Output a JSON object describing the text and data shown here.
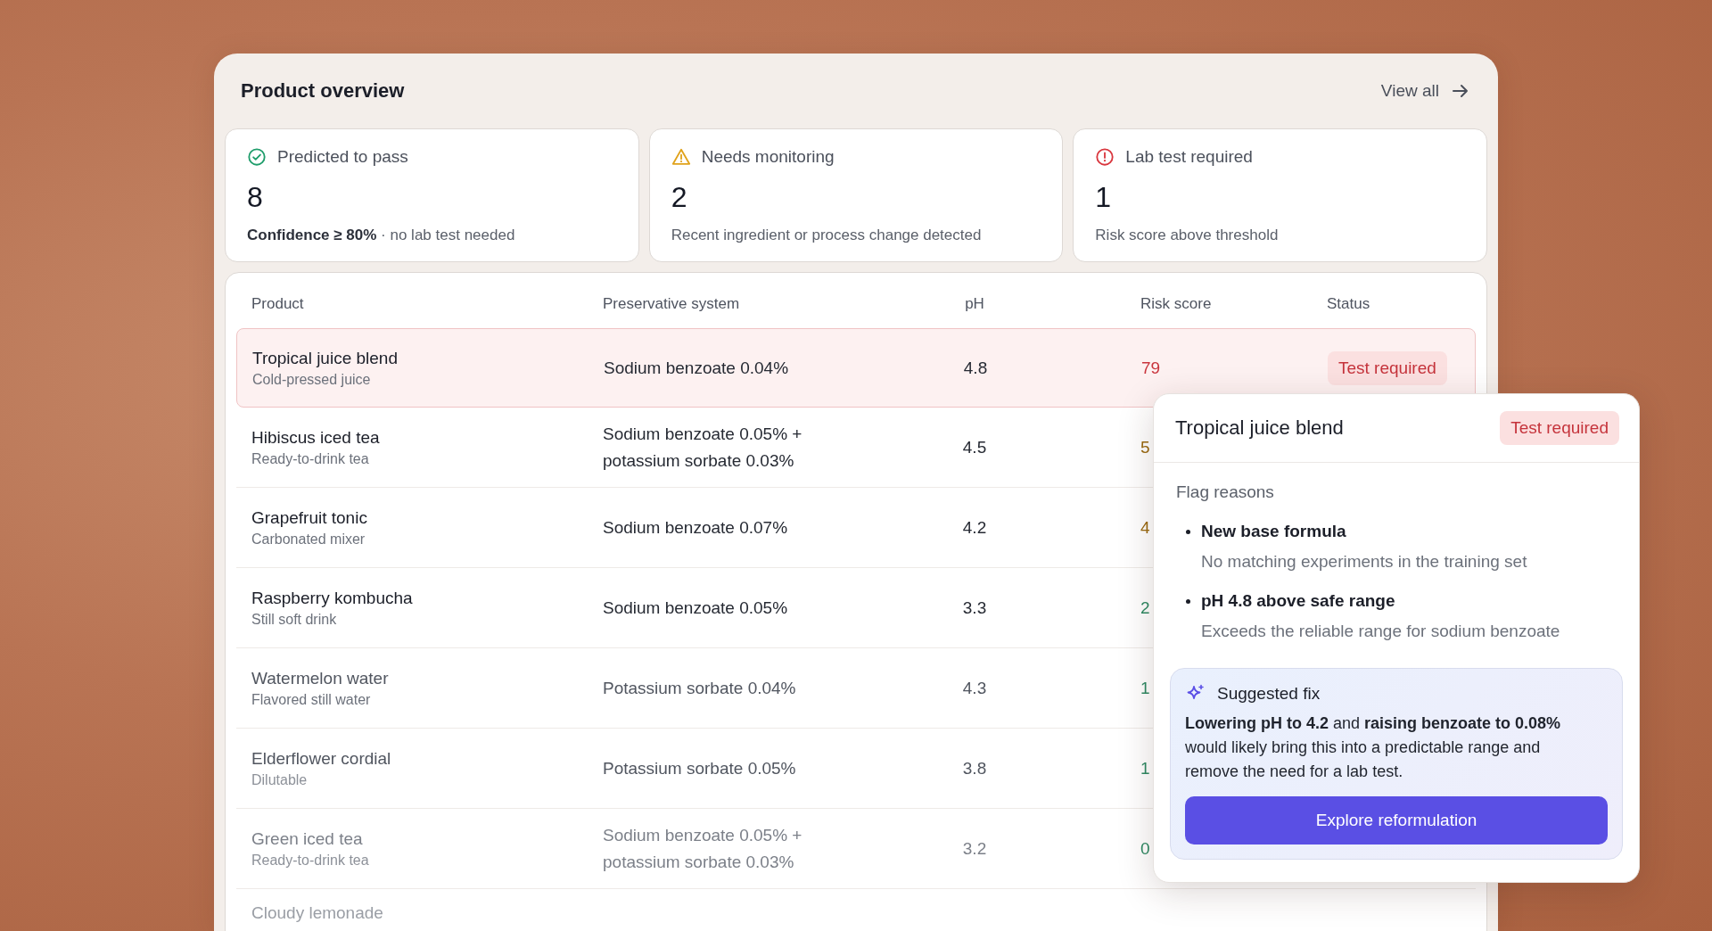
{
  "panel": {
    "title": "Product overview",
    "link": "View all"
  },
  "summary_cards": [
    {
      "kind": "pass",
      "label": "Predicted to pass",
      "count": "8",
      "note": "**Confidence ≥ 80%**  ·  no lab test needed"
    },
    {
      "kind": "warning",
      "label": "Needs monitoring",
      "count": "2",
      "note": "Recent ingredient or process change detected"
    },
    {
      "kind": "alert",
      "label": "Lab test required",
      "count": "1",
      "note": "Risk score above threshold"
    }
  ],
  "table": {
    "columns": [
      "Product",
      "Preservative system",
      "pH",
      "Risk score",
      "Status"
    ],
    "rows": [
      {
        "name": "Tropical juice blend",
        "subtitle": "Cold-pressed juice",
        "preservative": "Sodium benzoate 0.04%",
        "ph": "4.8",
        "risk": "79",
        "color": "#c9353d",
        "status": {
          "label": "Test required",
          "kind": "alert"
        },
        "selected": true
      },
      {
        "name": "Hibiscus iced tea",
        "subtitle": "Ready-to-drink tea",
        "preservative": "Sodium benzoate 0.05% + potassium sorbate 0.03%",
        "ph": "4.5",
        "risk": "5",
        "color": "#9a6a10",
        "selected": false
      },
      {
        "name": "Grapefruit tonic",
        "subtitle": "Carbonated mixer",
        "preservative": "Sodium benzoate 0.07%",
        "ph": "4.2",
        "risk": "4",
        "color": "#9a6a10",
        "selected": false
      },
      {
        "name": "Raspberry kombucha",
        "subtitle": "Still soft drink",
        "preservative": "Sodium benzoate 0.05%",
        "ph": "3.3",
        "risk": "2",
        "color": "#2e8a63",
        "selected": false
      },
      {
        "name": "Watermelon water",
        "subtitle": "Flavored still water",
        "preservative": "Potassium sorbate 0.04%",
        "ph": "4.3",
        "risk": "1",
        "color": "#2e8a63",
        "selected": false
      },
      {
        "name": "Elderflower cordial",
        "subtitle": "Dilutable",
        "preservative": "Potassium sorbate 0.05%",
        "ph": "3.8",
        "risk": "1",
        "color": "#2e8a63",
        "selected": false
      },
      {
        "name": "Green iced tea",
        "subtitle": "Ready-to-drink tea",
        "preservative": "Sodium benzoate 0.05% + potassium sorbate 0.03%",
        "ph": "3.2",
        "risk": "0",
        "color": "#2e8a63",
        "selected": false
      },
      {
        "name": "Cloudy lemonade",
        "selected": false
      }
    ]
  },
  "detail_popup": {
    "title": "Tropical juice blend",
    "status": {
      "label": "Test required",
      "kind": "alert"
    },
    "section_title": "Flag reasons",
    "reasons": [
      {
        "title": "New base formula",
        "detail": "No matching experiments in the training set"
      },
      {
        "title": "pH 4.8 above safe range",
        "detail": "Exceeds the reliable range for sodium benzoate"
      }
    ],
    "suggestion": {
      "title": "Suggested fix",
      "text": "**Lowering pH to 4.2** and **raising benzoate to 0.08%** would likely bring this into a predictable range and remove the need for a lab test.",
      "button": "Explore reformulation"
    }
  }
}
